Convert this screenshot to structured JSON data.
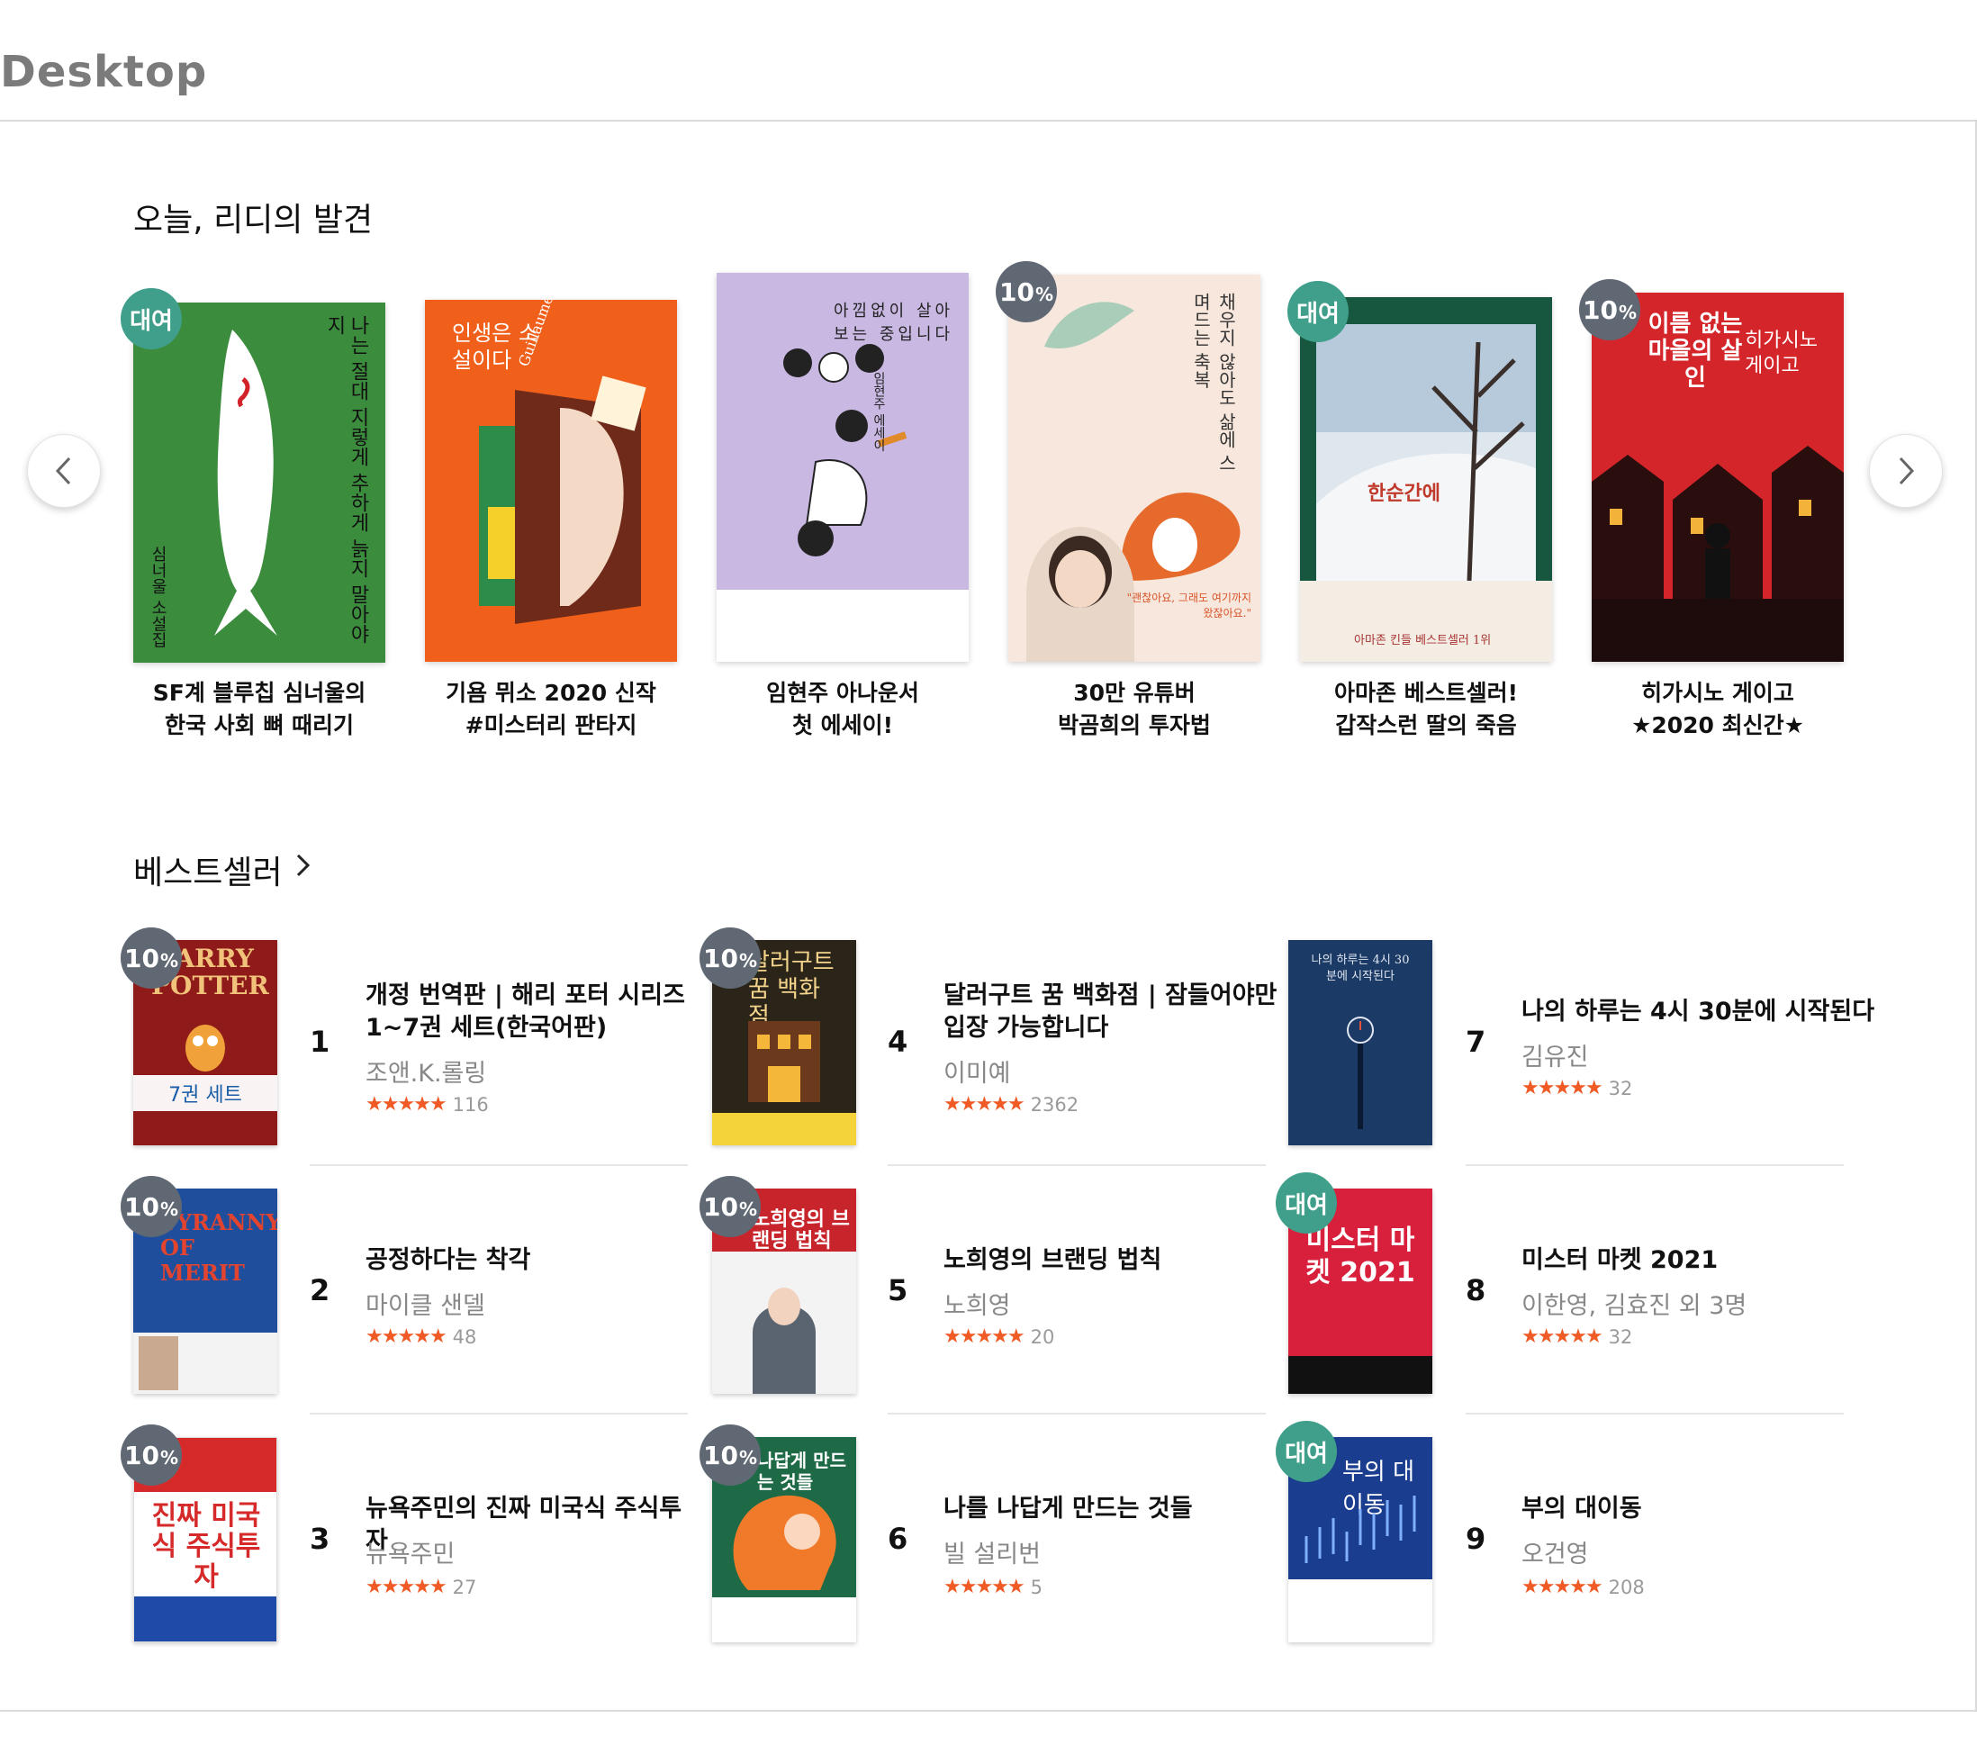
{
  "page": {
    "label": "Desktop"
  },
  "discover": {
    "title": "오늘, 리디의 발견",
    "books": [
      {
        "badge": "대여",
        "badge_type": "rental",
        "caption_line1": "SF계 블루칩 심너울의",
        "caption_line2": "한국 사회 뼈 때리기",
        "cover_title": "나는 절대 지렇게 추하게 늙지 말아야지",
        "cover_author": "심너울 소설집",
        "cover_color": "#3c8c3e"
      },
      {
        "badge": "",
        "badge_type": "none",
        "caption_line1": "기욤 뮈소 2020 신작",
        "caption_line2": "#미스터리 판타지",
        "cover_title": "인생은 소설이다",
        "cover_author": "Guillaume Musso",
        "cover_color": "#f0601a"
      },
      {
        "badge": "",
        "badge_type": "none",
        "caption_line1": "임현주 아나운서",
        "caption_line2": "첫 에세이!",
        "cover_title": "아낌없이 살아보는 중입니다",
        "cover_author": "임현주 에세이",
        "cover_color": "#c9b8e2"
      },
      {
        "badge": "10",
        "badge_type": "discount",
        "caption_line1": "30만 유튜버",
        "caption_line2": "박곰희의 투자법",
        "cover_title": "채우지 않아도 삶에 스며드는 축복",
        "cover_author": "\"괜찮아요, 그래도 여기까지 왔잖아요.\"",
        "cover_color": "#f8e7dc"
      },
      {
        "badge": "대여",
        "badge_type": "rental",
        "caption_line1": "아마존 베스트셀러!",
        "caption_line2": "갑작스런 딸의 죽음",
        "cover_title": "한순간에",
        "cover_author": "아마존 킨들 베스트셀러 1위",
        "cover_color": "#18573f"
      },
      {
        "badge": "10",
        "badge_type": "discount",
        "caption_line1": "히가시노 게이고",
        "caption_line2": "★2020 최신간★",
        "cover_title": "이름 없는 마을의 살인",
        "cover_author": "히가시노 게이고",
        "cover_color": "#d4262a"
      }
    ]
  },
  "bestseller": {
    "title": "베스트셀러",
    "pct_symbol": "%",
    "items": [
      {
        "rank": "1",
        "badge": "10",
        "badge_type": "discount",
        "title_line1": "개정 번역판 | 해리 포터 시리즈",
        "title_line2": "1~7권 세트(한국어판)",
        "author": "조앤.K.롤링",
        "stars": "★★★★★",
        "rating": 5.0,
        "count": "116",
        "cover_color": "#8f1a1a",
        "cover_text": "HARRY POTTER",
        "set_label": "7권 세트"
      },
      {
        "rank": "2",
        "badge": "10",
        "badge_type": "discount",
        "title_line1": "공정하다는 착각",
        "title_line2": "",
        "author": "마이클 샌델",
        "stars": "★★★★★",
        "rating": 4.5,
        "count": "48",
        "cover_color": "#1f4f9c",
        "cover_text": "TYRANNY OF MERIT"
      },
      {
        "rank": "3",
        "badge": "10",
        "badge_type": "discount",
        "title_line1": "뉴욕주민의 진짜 미국식 주식투자",
        "title_line2": "",
        "author": "뉴욕주민",
        "stars": "★★★★★",
        "rating": 5.0,
        "count": "27",
        "cover_color": "#ffffff",
        "cover_text": "진짜 미국식 주식투자"
      },
      {
        "rank": "4",
        "badge": "10",
        "badge_type": "discount",
        "title_line1": "달러구트 꿈 백화점 | 잠들어야만",
        "title_line2": "입장 가능합니다",
        "author": "이미예",
        "stars": "★★★★★",
        "rating": 4.5,
        "count": "2362",
        "cover_color": "#2b2418",
        "cover_text": "달러구트 꿈 백화점"
      },
      {
        "rank": "5",
        "badge": "10",
        "badge_type": "discount",
        "title_line1": "노희영의 브랜딩 법칙",
        "title_line2": "",
        "author": "노희영",
        "stars": "★★★★★",
        "rating": 4.5,
        "count": "20",
        "cover_color": "#f3f3f3",
        "cover_text": "노희영의 브랜딩 법칙"
      },
      {
        "rank": "6",
        "badge": "10",
        "badge_type": "discount",
        "title_line1": "나를 나답게 만드는 것들",
        "title_line2": "",
        "author": "빌 설리번",
        "stars": "★★★★★",
        "rating": 4.5,
        "count": "5",
        "cover_color": "#1f6a46",
        "cover_text": "나답게 만드는 것들"
      },
      {
        "rank": "7",
        "badge": "",
        "badge_type": "none",
        "title_line1": "나의 하루는 4시 30분에 시작된다",
        "title_line2": "",
        "author": "김유진",
        "stars": "★★★★★",
        "rating": 4.5,
        "count": "32",
        "cover_color": "#1c3a66",
        "cover_text": "나의 하루는 4시 30분에 시작된다"
      },
      {
        "rank": "8",
        "badge": "대여",
        "badge_type": "rental",
        "title_line1": "미스터 마켓 2021",
        "title_line2": "",
        "author": "이한영, 김효진 외 3명",
        "stars": "★★★★★",
        "rating": 4.5,
        "count": "32",
        "cover_color": "#d81f3b",
        "cover_text": "미스터 마켓 2021"
      },
      {
        "rank": "9",
        "badge": "대여",
        "badge_type": "rental",
        "title_line1": "부의 대이동",
        "title_line2": "",
        "author": "오건영",
        "stars": "★★★★★",
        "rating": 5.0,
        "count": "208",
        "cover_color": "#1b3d8f",
        "cover_text": "부의 대이동"
      }
    ]
  },
  "icons": {
    "prev": "chevron-left-icon",
    "next": "chevron-right-icon",
    "more": "chevron-right-icon"
  }
}
